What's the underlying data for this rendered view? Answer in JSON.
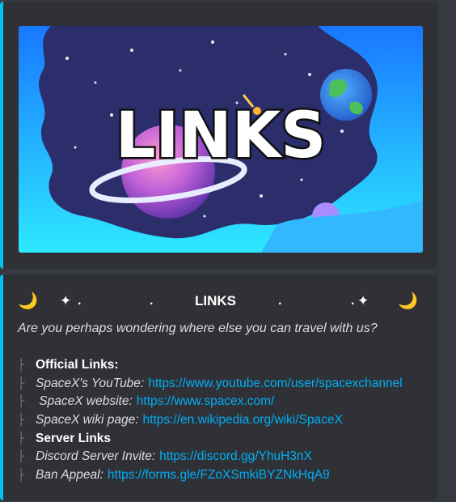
{
  "banner": {
    "word": "LINKS",
    "colors": {
      "sky_top": "#1a86ff",
      "sky_bottom": "#2ee6ff",
      "space": "#2b2e6b",
      "accent": "#03c2ee"
    }
  },
  "header": {
    "left_moon": "🌙",
    "left_sparkle": "✦",
    "dot1": ".",
    "dot2": ".",
    "title": "LINKS",
    "dot3": ".",
    "dot4": ".",
    "right_sparkle": "✦",
    "right_moon": "🌙"
  },
  "subtitle": "Are you perhaps wondering where else you can travel with us?",
  "branch_glyph": "├",
  "items": [
    {
      "type": "heading",
      "text": "Official Links:"
    },
    {
      "type": "link",
      "label": "SpaceX's YouTube:",
      "url": "https://www.youtube.com/user/spacexchannel"
    },
    {
      "type": "link",
      "label": " SpaceX website:",
      "url": "https://www.spacex.com/"
    },
    {
      "type": "link",
      "label": "SpaceX wiki page:",
      "url": "https://en.wikipedia.org/wiki/SpaceX"
    },
    {
      "type": "heading",
      "text": "Server Links"
    },
    {
      "type": "link",
      "label": "Discord Server Invite:",
      "url": "https://discord.gg/YhuH3nX"
    },
    {
      "type": "link",
      "label": "Ban Appeal:",
      "url": "https://forms.gle/FZoXSmkiBYZNkHqA9"
    }
  ]
}
